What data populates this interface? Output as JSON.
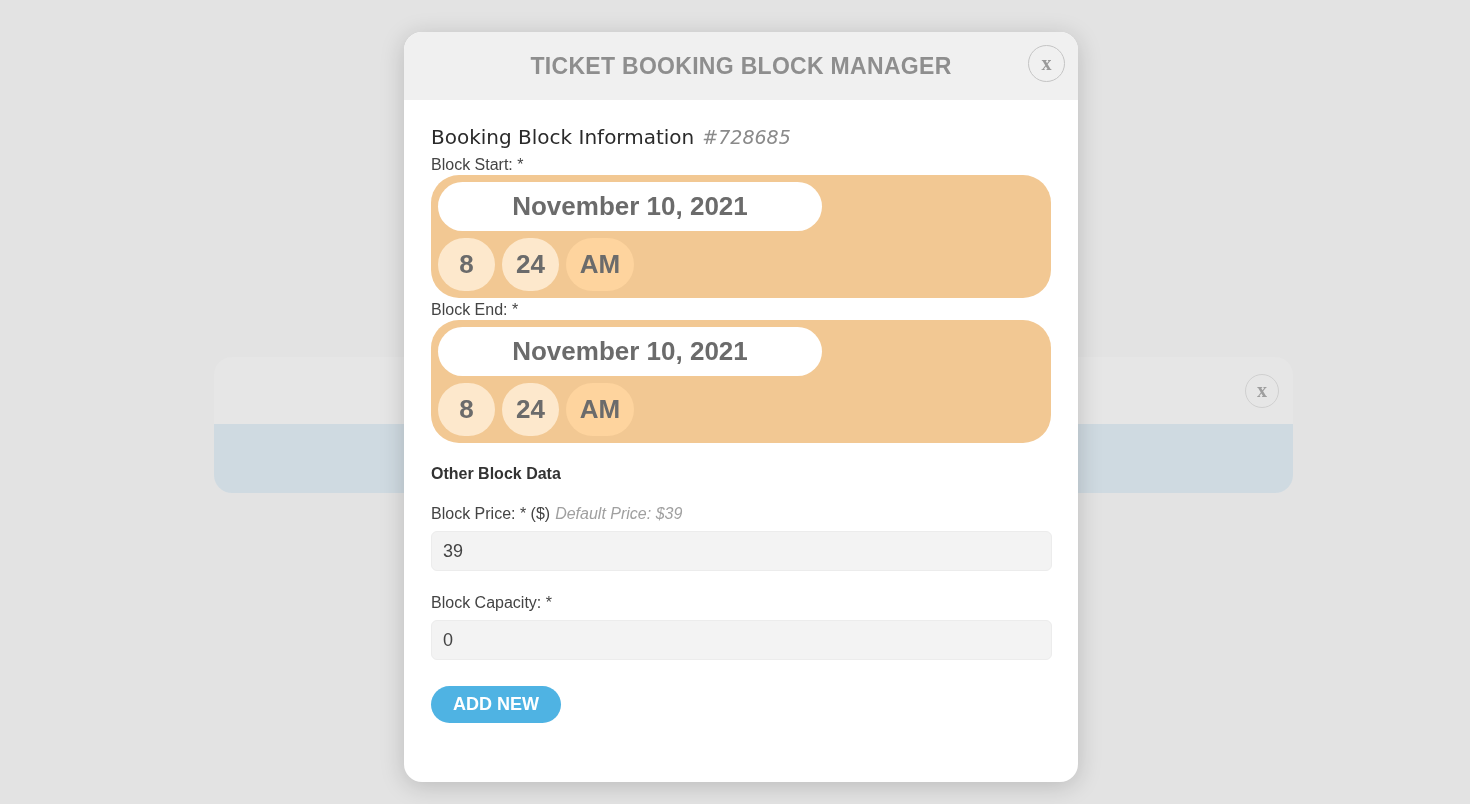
{
  "background_dialog": {
    "close": "x"
  },
  "modal": {
    "title": "TICKET BOOKING BLOCK MANAGER",
    "close": "x",
    "heading": "Booking Block Information",
    "block_id": "#728685",
    "datetimes": [
      {
        "label": "Block Start: *",
        "date": "November 10, 2021",
        "hour": "8",
        "minute": "24",
        "meridiem": "AM"
      },
      {
        "label": "Block End: *",
        "date": "November 10, 2021",
        "hour": "8",
        "minute": "24",
        "meridiem": "AM"
      }
    ],
    "section": "Other Block Data",
    "fields": [
      {
        "label": "Block Price: * ($)",
        "hint": "Default Price: $39",
        "value": "39"
      },
      {
        "label": "Block Capacity: *",
        "value": "0"
      }
    ],
    "button": "ADD NEW"
  }
}
